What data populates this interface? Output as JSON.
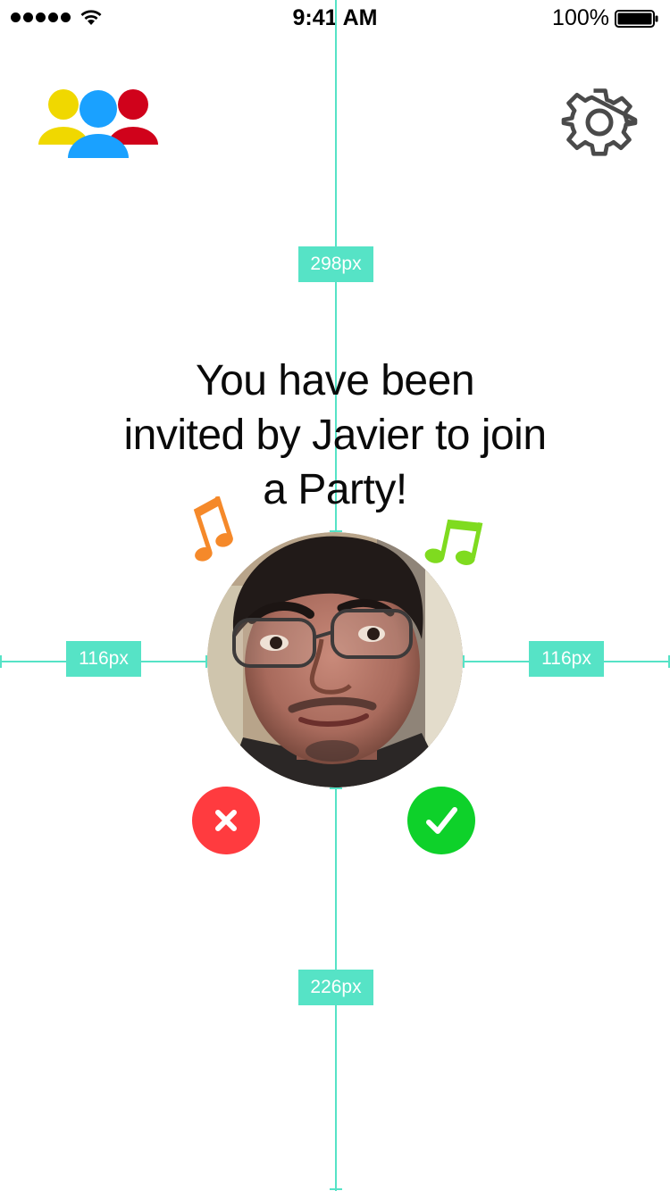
{
  "status_bar": {
    "time": "9:41 AM",
    "battery_percent": "100%",
    "signal_icon": "signal-dots-icon",
    "wifi_icon": "wifi-icon",
    "battery_icon": "battery-icon"
  },
  "header": {
    "friends_icon": "group-people-icon",
    "settings_icon": "gear-icon"
  },
  "invite": {
    "lines": [
      "You have been",
      "invited by Javier to join",
      "a Party!"
    ]
  },
  "avatar": {
    "icon": "profile-photo"
  },
  "actions": {
    "decline_icon": "close-icon",
    "accept_icon": "checkmark-icon",
    "decline_color": "#ff3b3f",
    "accept_color": "#0ed12a"
  },
  "decorations": {
    "note_left_icon": "music-note-icon",
    "note_left_color": "#f5892a",
    "note_right_icon": "music-note-icon",
    "note_right_color": "#7fdb1f"
  },
  "friends_icon_colors": [
    "#f0d800",
    "#1aa1ff",
    "#d0021b"
  ],
  "spec_overlay": {
    "top_distance": "298px",
    "left_distance": "116px",
    "right_distance": "116px",
    "bottom_distance": "226px",
    "guide_color": "#56e3c6"
  }
}
